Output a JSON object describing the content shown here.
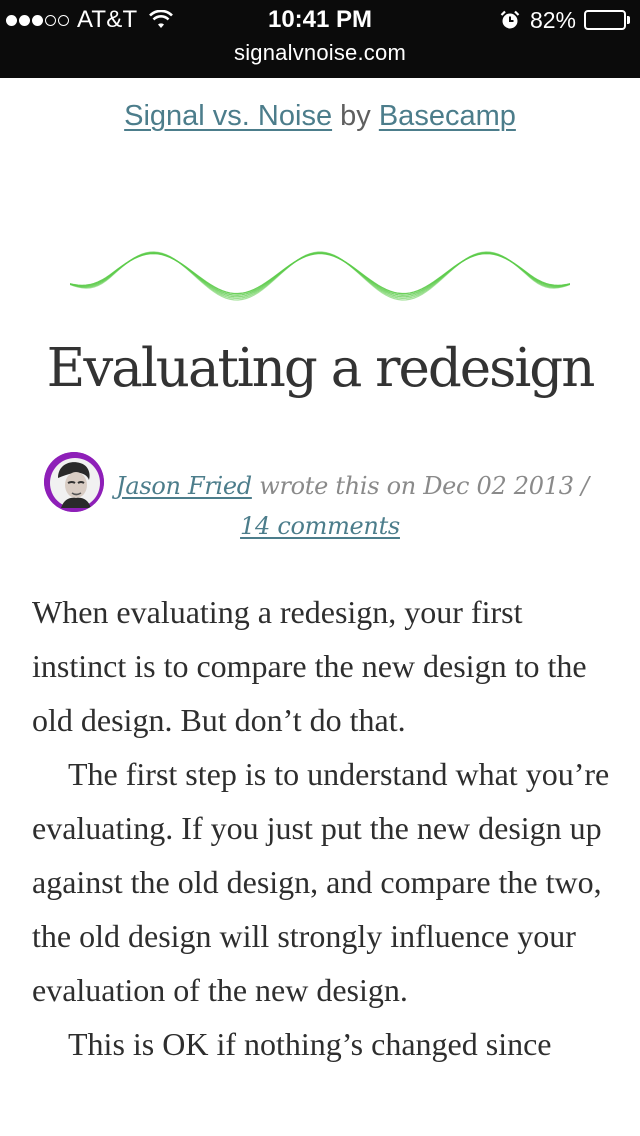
{
  "status_bar": {
    "signal_bars": [
      true,
      true,
      true,
      false,
      false
    ],
    "carrier": "AT&T",
    "time": "10:41 PM",
    "battery_percent": "82%",
    "battery_level": 0.82,
    "icons": [
      "wifi-icon",
      "alarm-icon",
      "battery-icon"
    ]
  },
  "browser": {
    "url": "signalvnoise.com"
  },
  "site": {
    "name": "Signal vs. Noise",
    "by": "by",
    "company": "Basecamp"
  },
  "post": {
    "title": "Evaluating a redesign",
    "author": "Jason Fried",
    "date_text": "wrote this on Dec 02 2013 /",
    "comments": "14 comments",
    "paragraphs": [
      "When evaluating a redesign, your first instinct is to compare the new design to the old design. But don’t do that.",
      "The first step is to understand what you’re evaluating. If you just put the new design up against the old design, and compare the two, the old design will strongly influence your evaluation of the new design.",
      "This is OK if nothing’s changed since"
    ]
  },
  "colors": {
    "link": "#4c7d8b",
    "wave": "#5ccb4a",
    "avatar_ring": "#8e1fb8",
    "status_bar_bg": "#0b0b0b"
  }
}
